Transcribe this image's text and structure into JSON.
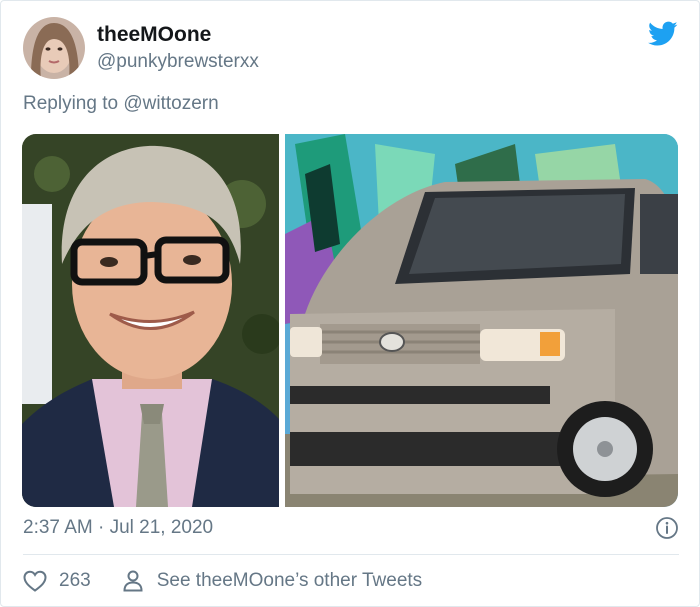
{
  "tweet": {
    "display_name": "theeMOone",
    "handle": "@punkybrewsterxx",
    "reply_prefix": "Replying to",
    "reply_mention": "@wittozern",
    "timestamp": "2:37 AM · Jul 21, 2020",
    "like_count": "263",
    "see_more_label": "See theeMOone’s other Tweets"
  },
  "colors": {
    "twitter_blue": "#1da1f2",
    "secondary_text": "#657786",
    "divider": "#e1e8ed"
  },
  "icons": {
    "brand": "twitter-bird-icon",
    "info": "info-icon",
    "like": "heart-icon",
    "profile": "person-icon"
  },
  "media": {
    "photos": [
      {
        "subject": "smiling-man-with-glasses"
      },
      {
        "subject": "silver-boxy-car-graffiti"
      }
    ]
  }
}
